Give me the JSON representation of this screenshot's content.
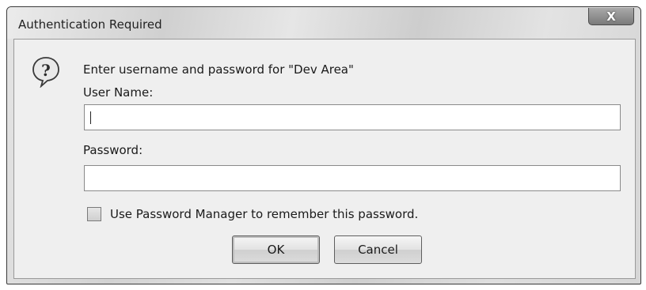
{
  "window": {
    "title": "Authentication Required",
    "close_label": "X"
  },
  "dialog": {
    "prompt": "Enter username and password for \"Dev Area\"",
    "icon": "question-icon",
    "username_label": "User Name:",
    "username_value": "",
    "password_label": "Password:",
    "password_value": "",
    "remember_label": "Use Password Manager to remember this password.",
    "remember_checked": false,
    "ok_label": "OK",
    "cancel_label": "Cancel"
  }
}
